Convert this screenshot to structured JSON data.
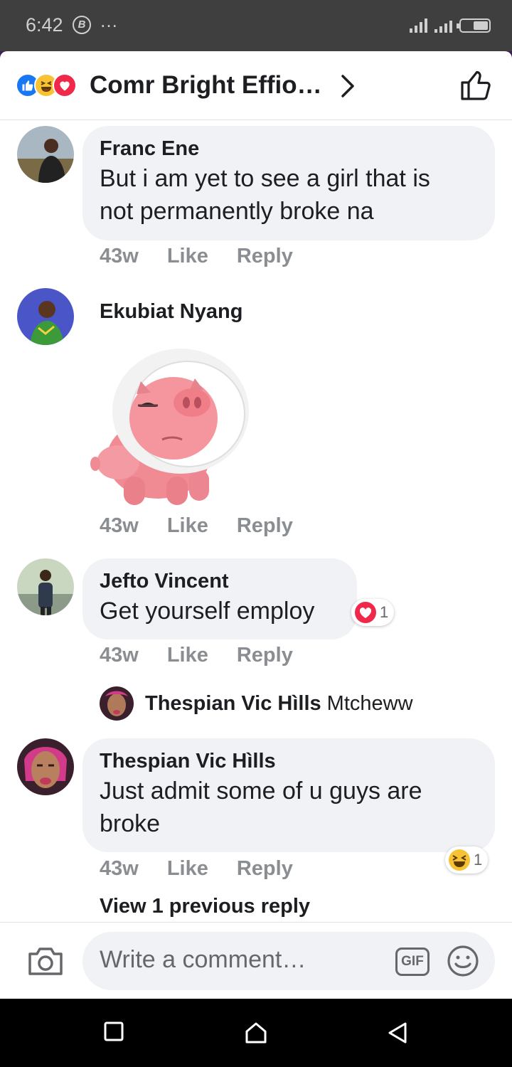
{
  "status_bar": {
    "time": "6:42",
    "b_badge": "B",
    "more": "…"
  },
  "header": {
    "title": "Comr Bright Effio…"
  },
  "comments": [
    {
      "author": "Franc Ene",
      "text_line1": "But i am yet to see a girl that is",
      "text_line2": "not permanently broke na",
      "age": "43w",
      "like": "Like",
      "reply": "Reply"
    },
    {
      "author": "Ekubiat Nyang",
      "sticker": "pig-with-cone-sticker",
      "age": "43w",
      "like": "Like",
      "reply": "Reply"
    },
    {
      "author": "Jefto Vincent",
      "text_line1": "Get yourself employ",
      "reaction_count": "1",
      "age": "43w",
      "like": "Like",
      "reply": "Reply",
      "reply_preview": {
        "author": "Thespian Vic Hìlls",
        "text": "Mtcheww"
      }
    },
    {
      "author": "Thespian Vic Hìlls",
      "text_line1": "Just admit some of u guys are",
      "text_line2": "broke",
      "reaction_count": "1",
      "age": "43w",
      "like": "Like",
      "reply": "Reply"
    }
  ],
  "view_previous": "View 1 previous reply",
  "composer": {
    "placeholder": "Write a comment…",
    "gif": "GIF"
  },
  "colors": {
    "facebook_blue": "#1877f2",
    "love_red": "#f0284a",
    "haha_yellow": "#f7c233",
    "bubble": "#f0f2f5"
  },
  "icons": [
    "camera-icon",
    "gif-icon",
    "emoji-icon",
    "thumbs-up-icon",
    "chevron-right-icon",
    "like-reaction-icon",
    "haha-reaction-icon",
    "love-reaction-icon"
  ]
}
